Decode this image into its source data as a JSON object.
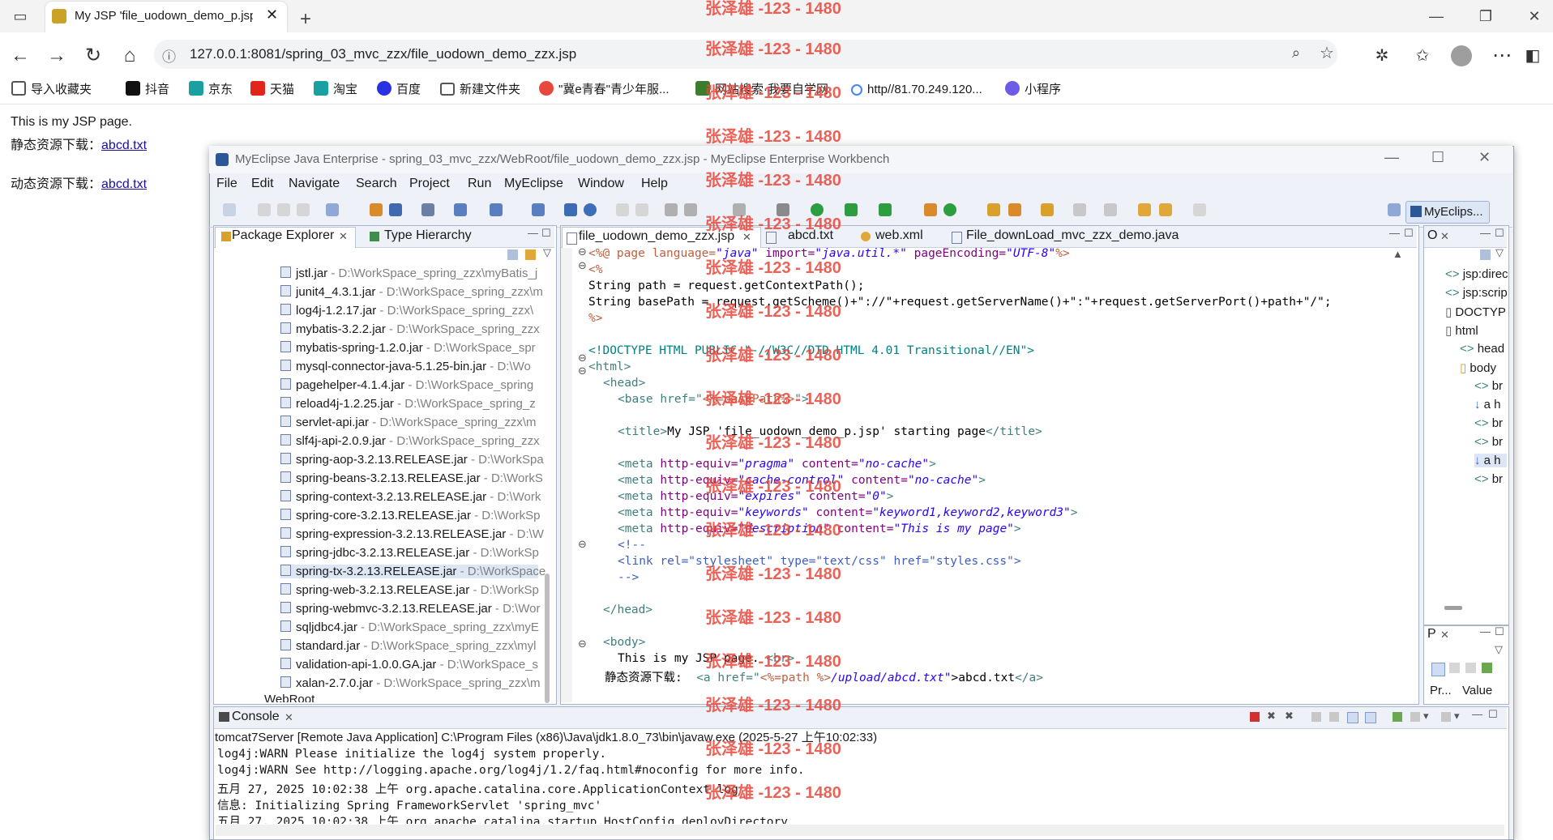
{
  "browser": {
    "tab_title": "My JSP 'file_uodown_demo_p.jsp'",
    "url": "127.0.0.1:8081/spring_03_mvc_zzx/file_uodown_demo_zzx.jsp",
    "favorites": [
      {
        "label": "导入收藏夹",
        "color": "#555555"
      },
      {
        "label": "抖音",
        "color": "#111111"
      },
      {
        "label": "京东",
        "color": "#e1251b"
      },
      {
        "label": "天猫",
        "color": "#ff0036"
      },
      {
        "label": "淘宝",
        "color": "#ff5000"
      },
      {
        "label": "百度",
        "color": "#2932e1"
      },
      {
        "label": "新建文件夹",
        "color": "#666666"
      },
      {
        "label": "\"冀e青春\"青少年服...",
        "color": "#e8473b"
      },
      {
        "label": "网站搜索·我要自学网",
        "color": "#3a7d2c"
      },
      {
        "label": "http//81.70.249.120...",
        "color": "#4285f4"
      },
      {
        "label": "小程序",
        "color": "#6c5ce7"
      }
    ]
  },
  "page": {
    "line1": "This is my JSP page.",
    "static_label": "静态资源下载：",
    "static_link": "abcd.txt",
    "dynamic_label": "动态资源下载：",
    "dynamic_link": "abcd.txt"
  },
  "ide": {
    "title": "MyEclipse Java Enterprise - spring_03_mvc_zzx/WebRoot/file_uodown_demo_zzx.jsp - MyEclipse Enterprise Workbench",
    "menu": [
      "File",
      "Edit",
      "Navigate",
      "Search",
      "Project",
      "Run",
      "MyEclipse",
      "Window",
      "Help"
    ],
    "perspective": "MyEclips...",
    "left_tabs": [
      "Package Explorer",
      "Type Hierarchy"
    ],
    "jars": [
      {
        "name": "jstl.jar",
        "path": " - D:\\WorkSpace_spring_zzx\\myBatis_j"
      },
      {
        "name": "junit4_4.3.1.jar",
        "path": " - D:\\WorkSpace_spring_zzx\\m"
      },
      {
        "name": "log4j-1.2.17.jar",
        "path": " - D:\\WorkSpace_spring_zzx\\"
      },
      {
        "name": "mybatis-3.2.2.jar",
        "path": " - D:\\WorkSpace_spring_zzx"
      },
      {
        "name": "mybatis-spring-1.2.0.jar",
        "path": " - D:\\WorkSpace_spr"
      },
      {
        "name": "mysql-connector-java-5.1.25-bin.jar",
        "path": " - D:\\Wo"
      },
      {
        "name": "pagehelper-4.1.4.jar",
        "path": " - D:\\WorkSpace_spring"
      },
      {
        "name": "reload4j-1.2.25.jar",
        "path": " - D:\\WorkSpace_spring_z"
      },
      {
        "name": "servlet-api.jar",
        "path": " - D:\\WorkSpace_spring_zzx\\m"
      },
      {
        "name": "slf4j-api-2.0.9.jar",
        "path": " - D:\\WorkSpace_spring_zzx"
      },
      {
        "name": "spring-aop-3.2.13.RELEASE.jar",
        "path": " - D:\\WorkSpa"
      },
      {
        "name": "spring-beans-3.2.13.RELEASE.jar",
        "path": " - D:\\WorkS"
      },
      {
        "name": "spring-context-3.2.13.RELEASE.jar",
        "path": " - D:\\Work"
      },
      {
        "name": "spring-core-3.2.13.RELEASE.jar",
        "path": " - D:\\WorkSp"
      },
      {
        "name": "spring-expression-3.2.13.RELEASE.jar",
        "path": " - D:\\W"
      },
      {
        "name": "spring-jdbc-3.2.13.RELEASE.jar",
        "path": " - D:\\WorkSp"
      },
      {
        "name": "spring-tx-3.2.13.RELEASE.jar",
        "path": " - D:\\WorkSpace"
      },
      {
        "name": "spring-web-3.2.13.RELEASE.jar",
        "path": " - D:\\WorkSp"
      },
      {
        "name": "spring-webmvc-3.2.13.RELEASE.jar",
        "path": " - D:\\Wor"
      },
      {
        "name": "sqljdbc4.jar",
        "path": " - D:\\WorkSpace_spring_zzx\\myE"
      },
      {
        "name": "standard.jar",
        "path": " - D:\\WorkSpace_spring_zzx\\myl"
      },
      {
        "name": "validation-api-1.0.0.GA.jar",
        "path": " - D:\\WorkSpace_s"
      },
      {
        "name": "xalan-2.7.0.jar",
        "path": " - D:\\WorkSpace_spring_zzx\\m"
      }
    ],
    "webroot": "WebRoot",
    "editor_tabs": [
      "file_uodown_demo_zzx.jsp",
      "abcd.txt",
      "web.xml",
      "File_downLoad_mvc_zzx_demo.java"
    ],
    "code": {
      "l1": [
        "<%@ page language=",
        "\"java\"",
        " import=",
        "\"java.util.*\"",
        " pageEncoding=",
        "\"UTF-8\"",
        "%>"
      ],
      "l2": "<%",
      "l3": "String path = request.getContextPath();",
      "l4": "String basePath = request.getScheme()+\"://\"+request.getServerName()+\":\"+request.getServerPort()+path+\"/\";",
      "l5": "%>",
      "l6": "<!DOCTYPE HTML PUBLIC \"-//W3C//DTD HTML 4.01 Transitional//EN\">",
      "l7": "<html>",
      "l8": "<head>",
      "l9a": "<base href=\"",
      "l9b": "<%=basePath%>",
      "l9c": "\">",
      "l10a": "<title>",
      "l10b": "My JSP 'file_uodown_demo_p.jsp' starting page",
      "l10c": "</title>",
      "meta1": [
        "<meta ",
        "http-equiv=",
        "\"pragma\"",
        " content=",
        "\"no-cache\"",
        ">"
      ],
      "meta2": [
        "<meta ",
        "http-equiv=",
        "\"cache-control\"",
        " content=",
        "\"no-cache\"",
        ">"
      ],
      "meta3": [
        "<meta ",
        "http-equiv=",
        "\"expires\"",
        " content=",
        "\"0\"",
        ">"
      ],
      "meta4": [
        "<meta ",
        "http-equiv=",
        "\"keywords\"",
        " content=",
        "\"keyword1,keyword2,keyword3\"",
        ">"
      ],
      "meta5": [
        "<meta ",
        "http-equiv=",
        "\"description\"",
        " content=",
        "\"This is my page\"",
        ">"
      ],
      "c1": "<!--",
      "c2": "<link rel=\"stylesheet\" type=\"text/css\" href=\"styles.css\">",
      "c3": "-->",
      "headend": "</head>",
      "body": "<body>",
      "text1": "This is my JSP page. ",
      "br": "<br>",
      "text2": "静态资源下载:  ",
      "a1": "<a href=\"",
      "a2": "<%=path %>",
      "a3": "/upload/abcd.txt\"",
      "a4": ">abcd.txt",
      "a5": "</a>"
    },
    "outline_tab": "O",
    "outline": [
      "jsp:direc",
      "jsp:scrip",
      "DOCTYP",
      "html",
      "head",
      "body",
      "br",
      "a h",
      "br",
      "br",
      "a h",
      "br"
    ],
    "props_tab": "P",
    "props_cols": [
      "Pr...",
      "Value"
    ],
    "console_tab": "Console",
    "console_header": "tomcat7Server [Remote Java Application] C:\\Program Files (x86)\\Java\\jdk1.8.0_73\\bin\\javaw.exe (2025-5-27 上午10:02:33)",
    "console_lines": [
      "log4j:WARN Please initialize the log4j system properly.",
      "log4j:WARN See http://logging.apache.org/log4j/1.2/faq.html#noconfig for more info.",
      "五月 27, 2025 10:02:38 上午 org.apache.catalina.core.ApplicationContext log",
      "信息: Initializing Spring FrameworkServlet 'spring_mvc'",
      "五月 27, 2025 10:02:38 上午 org.apache.catalina.startup.HostConfig deployDirectory"
    ]
  },
  "watermark": "张泽雄 -123 - 1480"
}
